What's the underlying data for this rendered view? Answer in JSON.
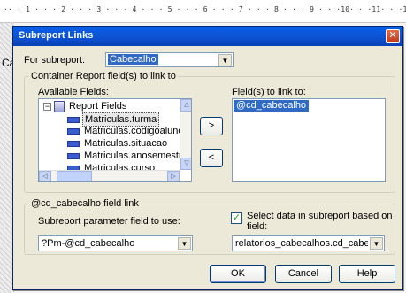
{
  "background": {
    "ruler_text": "·· · 1 · · · 2 · · · 3 · · · 4 · · · 5 · · · 6 · · · 7 · · · 8 · · · 9 · · ·10· · ·11· · ·12· · ·13·",
    "partial_label": "Ca"
  },
  "dialog": {
    "title": "Subreport Links",
    "close_symbol": "✕",
    "for_subreport": {
      "label": "For subreport:",
      "value": "Cabecalho"
    },
    "container_group": {
      "title": "Container Report field(s) to link to",
      "available_label": "Available Fields:",
      "tree": {
        "root": "Report Fields",
        "items": [
          "Matriculas.turma",
          "Matriculas.codigoaluno",
          "Matriculas.situacao",
          "Matriculas.anosemestre",
          "Matriculas.curso"
        ],
        "selected_item": "Matriculas.turma"
      },
      "add_button": ">",
      "remove_button": "<",
      "linked_label": "Field(s) to link to:",
      "linked_fields": [
        "@cd_cabecalho"
      ]
    },
    "link_group": {
      "title": "@cd_cabecalho field link",
      "param_label": "Subreport parameter field to use:",
      "param_value": "?Pm-@cd_cabecalho",
      "select_data_label_1": "Select data in subreport based on",
      "select_data_label_2": "field:",
      "select_data_checked": true,
      "select_data_field": "relatorios_cabecalhos.cd_cabecalho"
    },
    "buttons": {
      "ok": "OK",
      "cancel": "Cancel",
      "help": "Help"
    }
  },
  "icons": {
    "arrow_down": "▼",
    "arrow_up_small": "△",
    "arrow_down_small": "▽",
    "arrow_left_small": "◁",
    "arrow_right_small": "▷",
    "minus": "−",
    "check": "✓"
  }
}
